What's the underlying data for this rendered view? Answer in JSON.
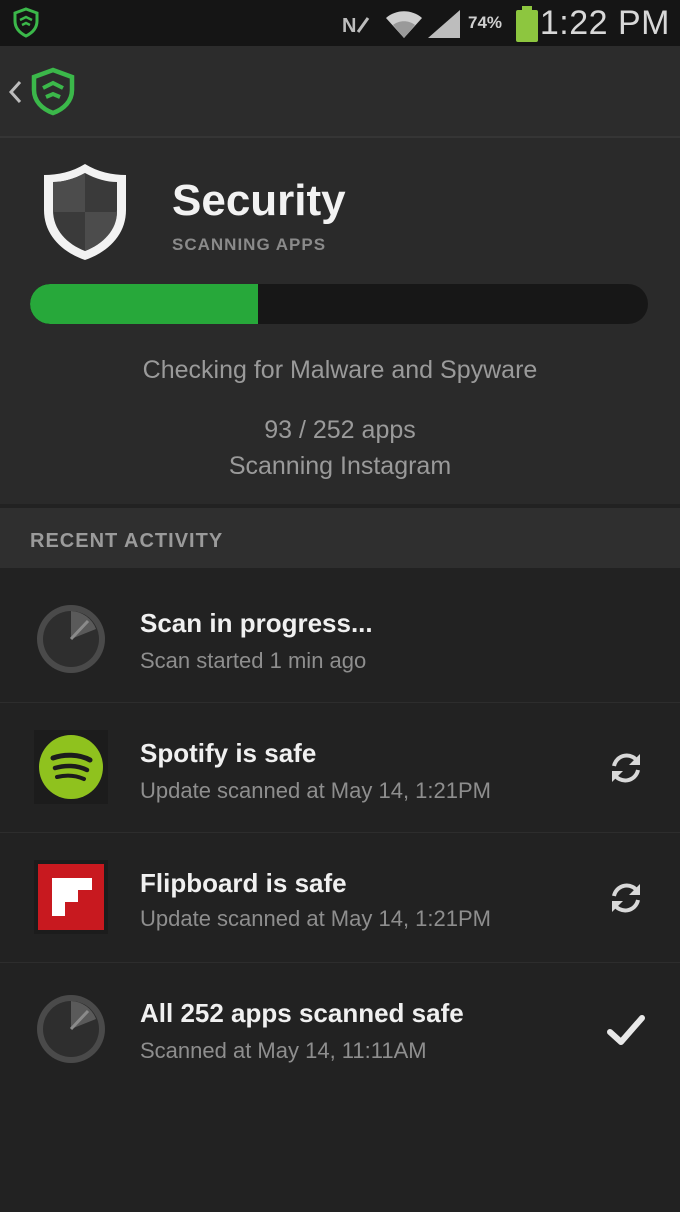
{
  "status_bar": {
    "battery_percent": "74%",
    "time": "1:22 PM"
  },
  "header": {
    "title": "Security",
    "subtitle": "SCANNING APPS",
    "progress": {
      "scanned": 93,
      "total": 252,
      "fraction": 0.369
    },
    "status_text": "Checking for Malware and Spyware",
    "count_text": "93 / 252 apps",
    "current_text": "Scanning Instagram"
  },
  "recent_activity": {
    "label": "RECENT ACTIVITY",
    "items": [
      {
        "title": "Scan in progress...",
        "subtitle": "Scan started 1 min ago",
        "icon": "scan-radar-icon",
        "action": ""
      },
      {
        "title": "Spotify is safe",
        "subtitle": "Update scanned at May 14, 1:21PM",
        "icon": "spotify-icon",
        "action": "rescan-icon"
      },
      {
        "title": "Flipboard is safe",
        "subtitle": "Update scanned at May 14, 1:21PM",
        "icon": "flipboard-icon",
        "action": "rescan-icon"
      },
      {
        "title": "All 252 apps scanned safe",
        "subtitle": "Scanned at May 14, 11:11AM",
        "icon": "scan-radar-icon",
        "action": "checkmark-icon"
      }
    ]
  },
  "colors": {
    "accent_green": "#27a83a",
    "brand_green": "#3bb84a",
    "spotify_green": "#8fc21e",
    "flipboard_red": "#c8191f",
    "background": "#222222"
  }
}
